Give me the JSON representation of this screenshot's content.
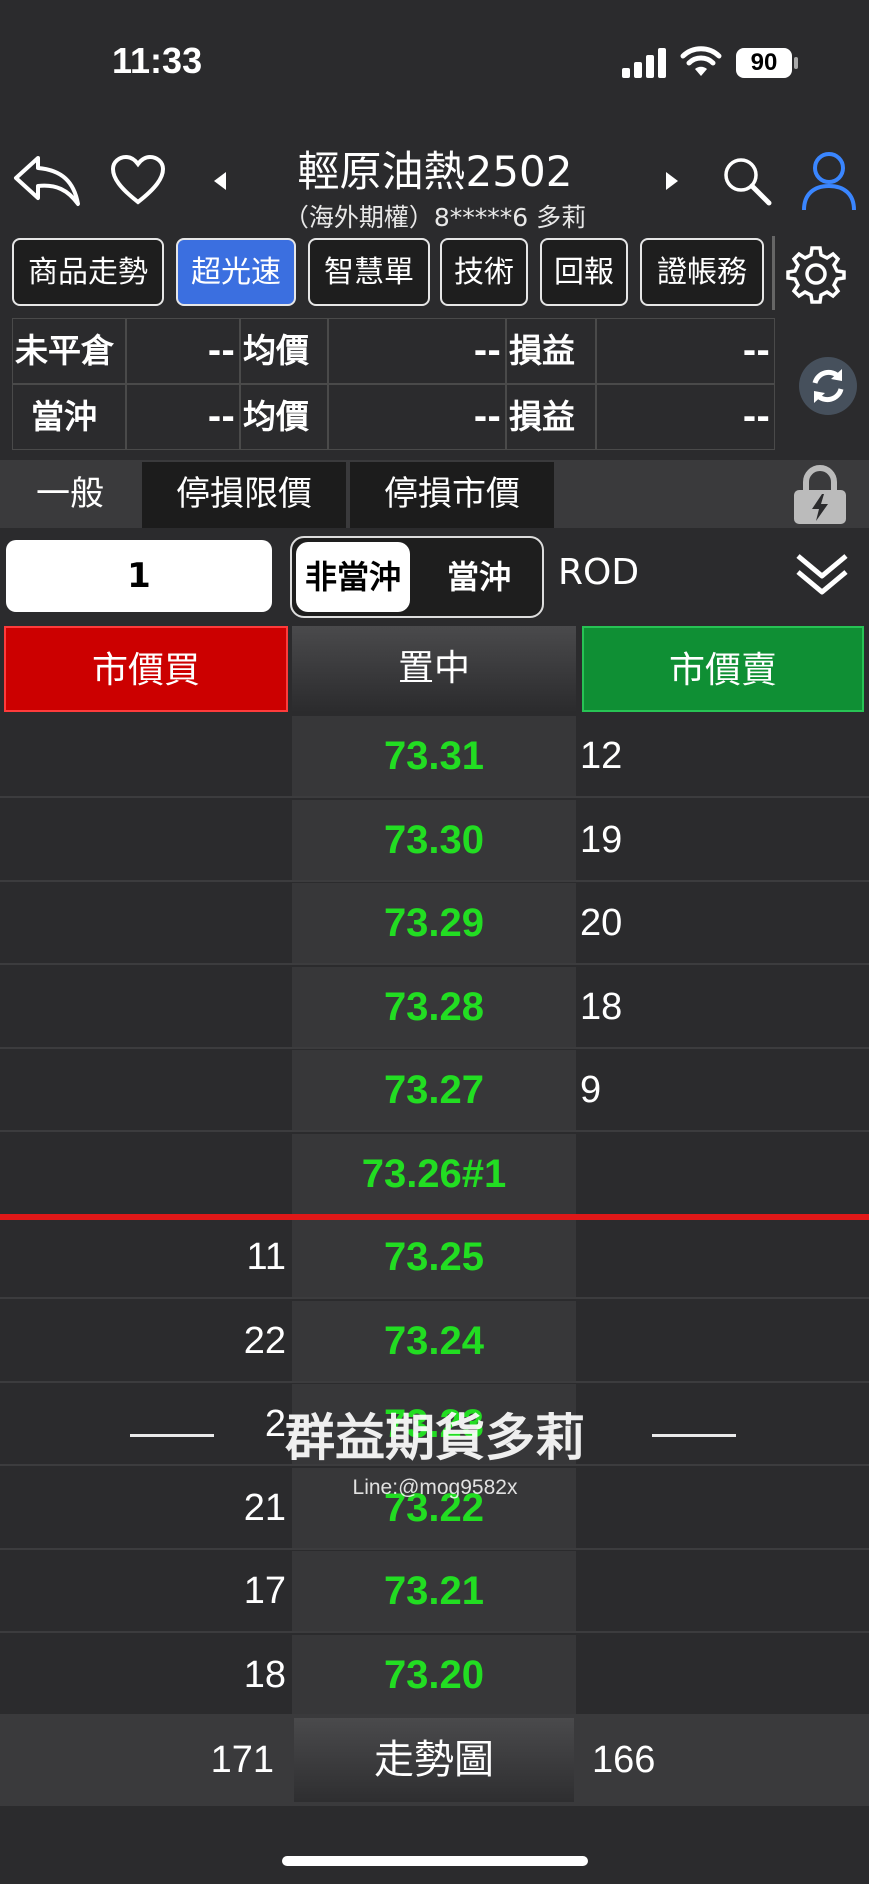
{
  "status_bar": {
    "time": "11:33",
    "battery": "90"
  },
  "header": {
    "title": "輕原油熱2502",
    "subtitle": "（海外期權）8*****6  多莉"
  },
  "tabs": [
    {
      "label": "商品走勢",
      "active": false
    },
    {
      "label": "超光速",
      "active": true
    },
    {
      "label": "智慧單",
      "active": false
    },
    {
      "label": "技術",
      "active": false
    },
    {
      "label": "回報",
      "active": false
    },
    {
      "label": "證帳務",
      "active": false
    }
  ],
  "position": {
    "rows": [
      {
        "label": "未平倉",
        "qty": "--",
        "avg_label": "均價",
        "avg": "--",
        "pnl_label": "損益",
        "pnl": "--"
      },
      {
        "label": "當沖",
        "qty": "--",
        "avg_label": "均價",
        "avg": "--",
        "pnl_label": "損益",
        "pnl": "--"
      }
    ]
  },
  "order_types": [
    {
      "label": "一般",
      "selected": true
    },
    {
      "label": "停損限價",
      "selected": false
    },
    {
      "label": "停損市價",
      "selected": false
    }
  ],
  "order": {
    "quantity": "1",
    "daytrade_off": "非當沖",
    "daytrade_on": "當沖",
    "time_in_force": "ROD"
  },
  "actions": {
    "market_buy": "市價買",
    "center": "置中",
    "market_sell": "市價賣"
  },
  "ladder": [
    {
      "buy": "",
      "price": "73.31",
      "sell": "12"
    },
    {
      "buy": "",
      "price": "73.30",
      "sell": "19"
    },
    {
      "buy": "",
      "price": "73.29",
      "sell": "20"
    },
    {
      "buy": "",
      "price": "73.28",
      "sell": "18"
    },
    {
      "buy": "",
      "price": "73.27",
      "sell": "9"
    },
    {
      "buy": "",
      "price": "73.26#1",
      "sell": ""
    },
    {
      "buy": "11",
      "price": "73.25",
      "sell": ""
    },
    {
      "buy": "22",
      "price": "73.24",
      "sell": ""
    },
    {
      "buy": "2",
      "price": "73.23",
      "sell": ""
    },
    {
      "buy": "21",
      "price": "73.22",
      "sell": ""
    },
    {
      "buy": "17",
      "price": "73.21",
      "sell": ""
    },
    {
      "buy": "18",
      "price": "73.20",
      "sell": ""
    }
  ],
  "footer": {
    "buy_total": "171",
    "chart_button": "走勢圖",
    "sell_total": "166"
  },
  "watermark": {
    "name": "群益期貨多莉",
    "line": "Line:@mog9582x"
  },
  "colors": {
    "buy": "#cc0000",
    "sell": "#0f8f34",
    "price": "#22dd22",
    "active_tab": "#3b6fe0"
  }
}
